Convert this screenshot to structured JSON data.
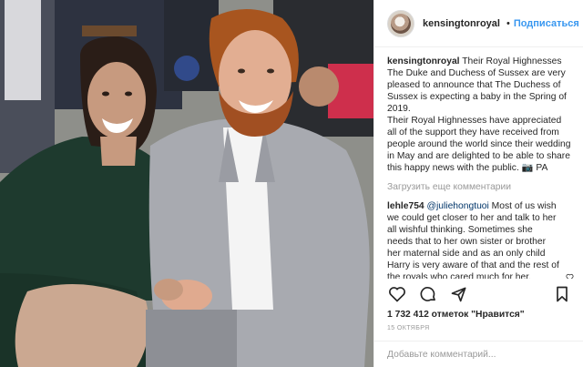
{
  "header": {
    "username": "kensingtonroyal",
    "separator": "•",
    "follow_label": "Подписаться"
  },
  "caption": {
    "username": "kensingtonroyal",
    "text": "Their Royal Highnesses The Duke and Duchess of Sussex are very pleased to announce that The Duchess of Sussex is expecting a baby in the Spring of 2019.",
    "text2": "Their Royal Highnesses have appreciated all of the support they have received from people around the world since their wedding in May and are delighted to be able to share this happy news with the public. 📷 PA"
  },
  "load_more_label": "Загрузить еще комментарии",
  "comment": {
    "username": "lehle754",
    "mention": "@juliehongtuoi",
    "text": " Most of us wish we could get closer to her and talk to her all wishful thinking. Sometimes she needs that to her own sister or brother her maternal side and as an only child Harry is very aware of that and the rest of the royals who cared much for her."
  },
  "likes_text": "1 732 412 отметок \"Нравится\"",
  "date_text": "15 ОКТЯБРЯ",
  "add_comment_placeholder": "Добавьте комментарий...",
  "colors": {
    "accent": "#3897f0",
    "verified": "#3897f0",
    "muted": "#999999",
    "text": "#262626"
  },
  "icons": {
    "verified": "verified-badge-icon",
    "like": "heart-icon",
    "comment": "comment-bubble-icon",
    "share": "share-icon",
    "save": "bookmark-icon",
    "comment_like": "heart-small-icon"
  }
}
